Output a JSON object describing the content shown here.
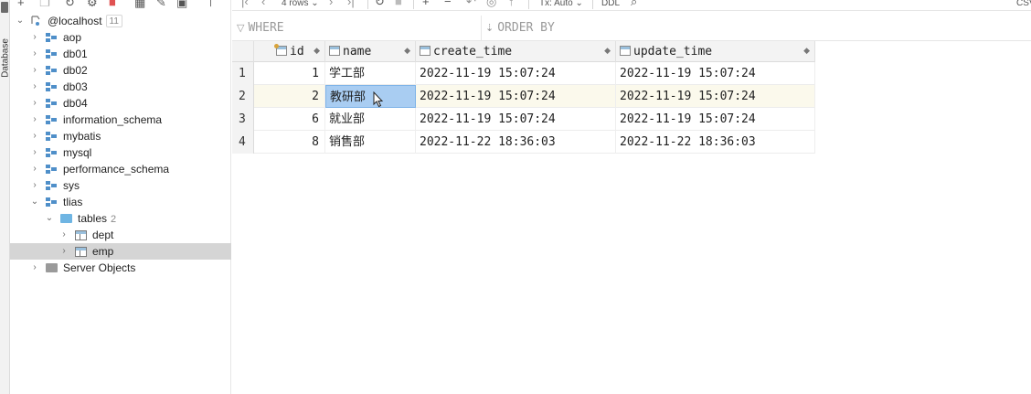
{
  "sidebar_strip": {
    "label": "Database"
  },
  "tree": {
    "root": {
      "label": "@localhost",
      "count": "11"
    },
    "databases": [
      {
        "label": "aop"
      },
      {
        "label": "db01"
      },
      {
        "label": "db02"
      },
      {
        "label": "db03"
      },
      {
        "label": "db04"
      },
      {
        "label": "information_schema"
      },
      {
        "label": "mybatis"
      },
      {
        "label": "mysql"
      },
      {
        "label": "performance_schema"
      },
      {
        "label": "sys"
      },
      {
        "label": "tlias"
      }
    ],
    "tables_folder": {
      "label": "tables",
      "count": "2"
    },
    "tables": [
      {
        "label": "dept"
      },
      {
        "label": "emp"
      }
    ],
    "server_objects": {
      "label": "Server Objects"
    }
  },
  "toolbar": {
    "rows_label": "4 rows",
    "tx_label": "Tx: Auto",
    "ddl_label": "DDL",
    "csv_label": "CSV"
  },
  "filter": {
    "where_placeholder": "WHERE",
    "order_placeholder": "ORDER BY"
  },
  "grid": {
    "columns": [
      "id",
      "name",
      "create_time",
      "update_time"
    ],
    "rows": [
      {
        "num": "1",
        "id": "1",
        "name": "学工部",
        "create_time": "2022-11-19 15:07:24",
        "update_time": "2022-11-19 15:07:24"
      },
      {
        "num": "2",
        "id": "2",
        "name": "教研部",
        "create_time": "2022-11-19 15:07:24",
        "update_time": "2022-11-19 15:07:24"
      },
      {
        "num": "3",
        "id": "6",
        "name": "就业部",
        "create_time": "2022-11-19 15:07:24",
        "update_time": "2022-11-19 15:07:24"
      },
      {
        "num": "4",
        "id": "8",
        "name": "销售部",
        "create_time": "2022-11-22 18:36:03",
        "update_time": "2022-11-22 18:36:03"
      }
    ]
  },
  "colors": {
    "selection": "#a9cdf2",
    "current_row": "#fbf9ec",
    "tree_selected": "#d5d5d5",
    "db_icon": "#4f8fc9",
    "folder_icon": "#6fb5e3"
  }
}
